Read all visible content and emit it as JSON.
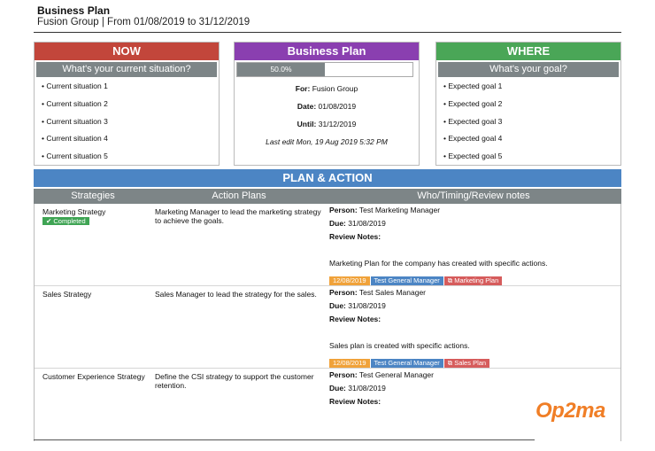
{
  "header": {
    "title": "Business Plan",
    "subtitle": "Fusion Group | From 01/08/2019 to 31/12/2019"
  },
  "now_panel": {
    "title": "NOW",
    "subtitle": "What's your current situation?",
    "color": "#c2463b",
    "items": [
      "Current situation 1",
      "Current situation 2",
      "Current situation 3",
      "Current situation 4",
      "Current situation 5"
    ]
  },
  "center_panel": {
    "title": "Business Plan",
    "color": "#8a3fb0",
    "progress_label": "50.0%",
    "progress_fraction": 0.5,
    "for_label": "For:",
    "for_value": "Fusion Group",
    "date_label": "Date:",
    "date_value": "01/08/2019",
    "until_label": "Until:",
    "until_value": "31/12/2019",
    "last_edit": "Last edit Mon, 19 Aug 2019 5:32 PM"
  },
  "where_panel": {
    "title": "WHERE",
    "subtitle": "What's your goal?",
    "color": "#4aa657",
    "items": [
      "Expected goal 1",
      "Expected goal 2",
      "Expected goal 3",
      "Expected goal 4",
      "Expected goal 5"
    ]
  },
  "plan": {
    "title": "PLAN & ACTION",
    "columns": [
      "Strategies",
      "Action Plans",
      "Who/Timing/Review notes"
    ],
    "person_label": "Person:",
    "due_label": "Due:",
    "notes_label": "Review Notes:",
    "rows": [
      {
        "strategy": "Marketing Strategy",
        "status": "✔ Completed",
        "action": "Marketing Manager to lead the marketing strategy to achieve the goals.",
        "person": "Test Marketing Manager",
        "due": "31/08/2019",
        "notes": "Marketing Plan for the company has created with specific actions.",
        "tag_date": "12/08/2019",
        "tag_person": "Test General Manager",
        "tag_link": "Marketing Plan"
      },
      {
        "strategy": "Sales Strategy",
        "action": "Sales Manager to lead the strategy for the sales.",
        "person": "Test Sales Manager",
        "due": "31/08/2019",
        "notes": "Sales plan is created with specific actions.",
        "tag_date": "12/08/2019",
        "tag_person": "Test General Manager",
        "tag_link": "Sales Plan"
      },
      {
        "strategy": "Customer Experience Strategy",
        "action": "Define the CSI strategy to support the customer retention.",
        "person": "Test General Manager",
        "due": "31/08/2019",
        "notes": ""
      }
    ]
  },
  "logo_text": "Op2ma"
}
